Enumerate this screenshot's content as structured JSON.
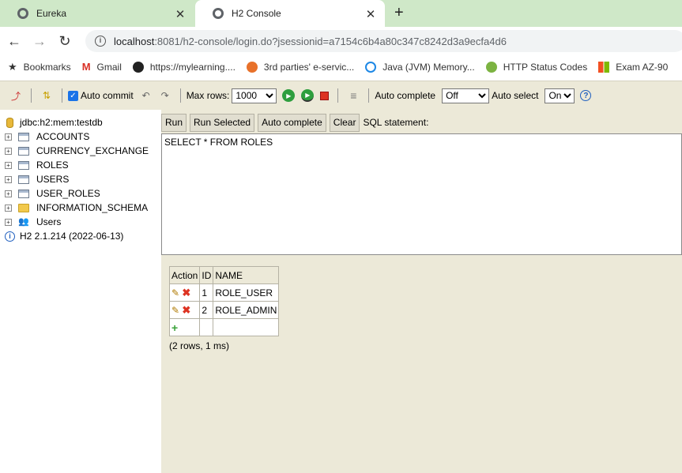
{
  "browser": {
    "tabs": [
      {
        "title": "Eureka",
        "active": false
      },
      {
        "title": "H2 Console",
        "active": true
      }
    ],
    "new_tab": "+",
    "close_glyph": "✕",
    "url_host": "localhost",
    "url_rest": ":8081/h2-console/login.do?jsessionid=a7154c6b4a80c347c8242d3a9ecfa4d6",
    "bookmarks": [
      {
        "label": "Bookmarks",
        "icon": "star-icon"
      },
      {
        "label": "Gmail",
        "icon": "gmail-icon"
      },
      {
        "label": "https://mylearning....",
        "icon": "globe-icon"
      },
      {
        "label": "3rd parties' e-servic...",
        "icon": "site-icon"
      },
      {
        "label": "Java (JVM) Memory...",
        "icon": "site-icon"
      },
      {
        "label": "HTTP Status Codes",
        "icon": "site-icon"
      },
      {
        "label": "Exam AZ-90",
        "icon": "microsoft-icon"
      }
    ]
  },
  "toolbar": {
    "auto_commit_label": "Auto commit",
    "max_rows_label": "Max rows:",
    "max_rows_value": "1000",
    "auto_complete_label": "Auto complete",
    "auto_complete_value": "Off",
    "auto_select_label": "Auto select",
    "auto_select_value": "On",
    "help_glyph": "?"
  },
  "tree": {
    "db": "jdbc:h2:mem:testdb",
    "tables": [
      "ACCOUNTS",
      "CURRENCY_EXCHANGE",
      "ROLES",
      "USERS",
      "USER_ROLES"
    ],
    "schema": "INFORMATION_SCHEMA",
    "users": "Users",
    "version": "H2 2.1.214 (2022-06-13)"
  },
  "sql": {
    "buttons": [
      "Run",
      "Run Selected",
      "Auto complete",
      "Clear"
    ],
    "label": "SQL statement:",
    "query": "SELECT * FROM ROLES"
  },
  "result": {
    "columns": [
      "Action",
      "ID",
      "NAME"
    ],
    "rows": [
      {
        "id": "1",
        "name": "ROLE_USER"
      },
      {
        "id": "2",
        "name": "ROLE_ADMIN"
      }
    ],
    "summary": "(2 rows, 1 ms)"
  }
}
